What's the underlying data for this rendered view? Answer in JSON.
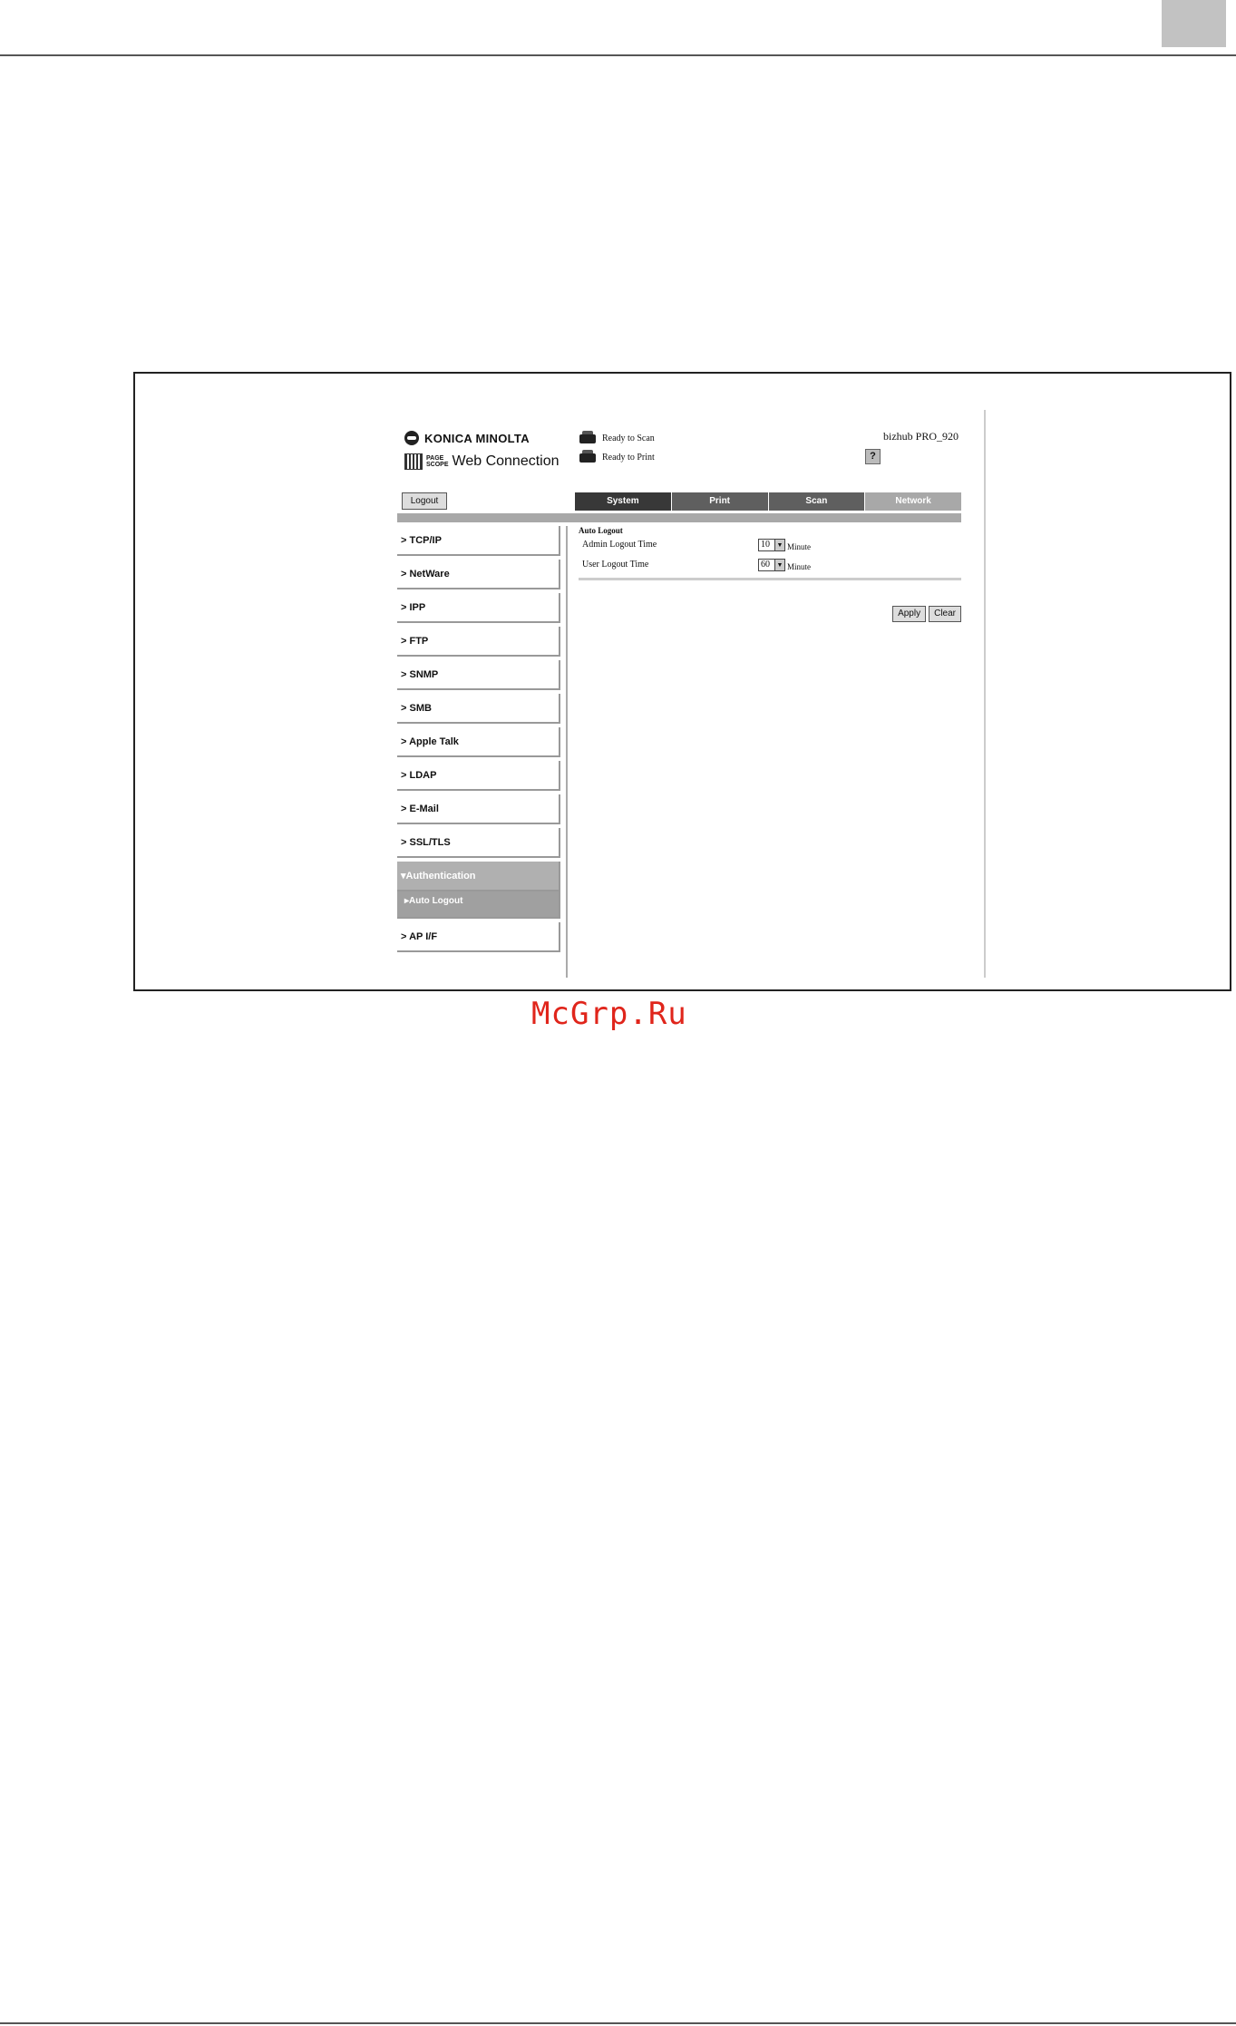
{
  "page": {
    "watermark": "McGrp.Ru"
  },
  "header": {
    "brand": "KONICA MINOLTA",
    "product_small_line1": "PAGE",
    "product_small_line2": "SCOPE",
    "product": "Web Connection",
    "status_scan": "Ready to Scan",
    "status_print": "Ready to Print",
    "model": "bizhub PRO_920",
    "help_label": "?",
    "logout_label": "Logout"
  },
  "tabs": [
    {
      "label": "System"
    },
    {
      "label": "Print"
    },
    {
      "label": "Scan"
    },
    {
      "label": "Network"
    }
  ],
  "sidebar": {
    "items": [
      {
        "label": "> TCP/IP"
      },
      {
        "label": "> NetWare"
      },
      {
        "label": "> IPP"
      },
      {
        "label": "> FTP"
      },
      {
        "label": "> SNMP"
      },
      {
        "label": "> SMB"
      },
      {
        "label": "> Apple Talk"
      },
      {
        "label": "> LDAP"
      },
      {
        "label": "> E-Mail"
      },
      {
        "label": "> SSL/TLS"
      },
      {
        "label": "▾Authentication"
      },
      {
        "label": "▸Auto Logout"
      },
      {
        "label": "> AP I/F"
      }
    ]
  },
  "main": {
    "section_title": "Auto Logout",
    "settings": [
      {
        "label": "Admin Logout Time",
        "value": "10",
        "unit": "Minute"
      },
      {
        "label": "User Logout Time",
        "value": "60",
        "unit": "Minute"
      }
    ],
    "apply_label": "Apply",
    "clear_label": "Clear"
  },
  "icons": {
    "dropdown_arrow": "▼"
  }
}
